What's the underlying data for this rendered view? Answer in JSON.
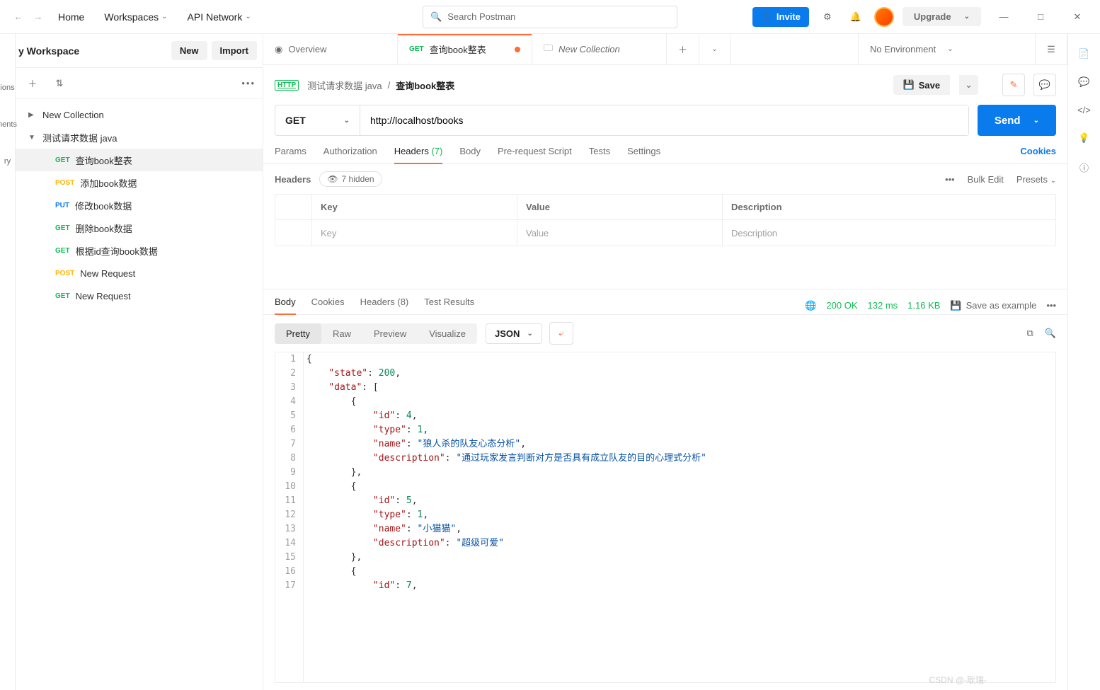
{
  "topbar": {
    "home": "Home",
    "workspaces": "Workspaces",
    "api_network": "API Network",
    "search_placeholder": "Search Postman",
    "invite": "Invite",
    "upgrade": "Upgrade"
  },
  "sidebar": {
    "workspace_title": "y Workspace",
    "new_btn": "New",
    "import_btn": "Import",
    "rail": {
      "ions": "ions",
      "nents": "nents",
      "ry": "ry"
    },
    "tree": [
      {
        "type": "folder",
        "label": "New Collection",
        "chev": "▶"
      },
      {
        "type": "folder",
        "label": "测试请求数据 java",
        "chev": "▼"
      },
      {
        "type": "req",
        "method": "GET",
        "label": "查询book整表",
        "active": true
      },
      {
        "type": "req",
        "method": "POST",
        "label": "添加book数据"
      },
      {
        "type": "req",
        "method": "PUT",
        "label": "修改book数据"
      },
      {
        "type": "req",
        "method": "GET",
        "label": "删除book数据"
      },
      {
        "type": "req",
        "method": "GET",
        "label": "根据id查询book数据"
      },
      {
        "type": "req",
        "method": "POST",
        "label": "New Request"
      },
      {
        "type": "req",
        "method": "GET",
        "label": "New Request"
      }
    ]
  },
  "tabs": {
    "items": [
      {
        "icon": "overview",
        "label": "Overview"
      },
      {
        "method": "GET",
        "label": "查询book整表",
        "active": true,
        "dirty": true
      },
      {
        "icon": "collection",
        "label": "New Collection",
        "italic": true
      }
    ],
    "env": "No Environment"
  },
  "request": {
    "breadcrumb_parent": "测试请求数据 java",
    "breadcrumb_name": "查询book整表",
    "save": "Save",
    "method": "GET",
    "url": "http://localhost/books",
    "send": "Send",
    "subtabs": {
      "params": "Params",
      "auth": "Authorization",
      "headers": "Headers",
      "headers_count": "(7)",
      "body": "Body",
      "prereq": "Pre-request Script",
      "tests": "Tests",
      "settings": "Settings",
      "cookies": "Cookies"
    },
    "headers_section": {
      "title": "Headers",
      "hidden": "7 hidden",
      "bulk_edit": "Bulk Edit",
      "presets": "Presets",
      "cols": {
        "key": "Key",
        "value": "Value",
        "desc": "Description"
      },
      "placeholder": {
        "key": "Key",
        "value": "Value",
        "desc": "Description"
      }
    }
  },
  "response": {
    "tabs": {
      "body": "Body",
      "cookies": "Cookies",
      "headers": "Headers",
      "headers_count": "(8)",
      "test_results": "Test Results"
    },
    "status_code": "200 OK",
    "time": "132 ms",
    "size": "1.16 KB",
    "save_example": "Save as example",
    "view_modes": {
      "pretty": "Pretty",
      "raw": "Raw",
      "preview": "Preview",
      "visualize": "Visualize"
    },
    "format": "JSON",
    "code_lines": [
      [
        [
          "punc",
          "{"
        ]
      ],
      [
        [
          "pad",
          "    "
        ],
        [
          "key",
          "\"state\""
        ],
        [
          "punc",
          ": "
        ],
        [
          "num",
          "200"
        ],
        [
          "punc",
          ","
        ]
      ],
      [
        [
          "pad",
          "    "
        ],
        [
          "key",
          "\"data\""
        ],
        [
          "punc",
          ": ["
        ]
      ],
      [
        [
          "pad",
          "        "
        ],
        [
          "punc",
          "{"
        ]
      ],
      [
        [
          "pad",
          "            "
        ],
        [
          "key",
          "\"id\""
        ],
        [
          "punc",
          ": "
        ],
        [
          "num",
          "4"
        ],
        [
          "punc",
          ","
        ]
      ],
      [
        [
          "pad",
          "            "
        ],
        [
          "key",
          "\"type\""
        ],
        [
          "punc",
          ": "
        ],
        [
          "num",
          "1"
        ],
        [
          "punc",
          ","
        ]
      ],
      [
        [
          "pad",
          "            "
        ],
        [
          "key",
          "\"name\""
        ],
        [
          "punc",
          ": "
        ],
        [
          "str",
          "\"狼人杀的队友心态分析\""
        ],
        [
          "punc",
          ","
        ]
      ],
      [
        [
          "pad",
          "            "
        ],
        [
          "key",
          "\"description\""
        ],
        [
          "punc",
          ": "
        ],
        [
          "str",
          "\"通过玩家发言判断对方是否具有成立队友的目的心理式分析\""
        ]
      ],
      [
        [
          "pad",
          "        "
        ],
        [
          "punc",
          "},"
        ]
      ],
      [
        [
          "pad",
          "        "
        ],
        [
          "punc",
          "{"
        ]
      ],
      [
        [
          "pad",
          "            "
        ],
        [
          "key",
          "\"id\""
        ],
        [
          "punc",
          ": "
        ],
        [
          "num",
          "5"
        ],
        [
          "punc",
          ","
        ]
      ],
      [
        [
          "pad",
          "            "
        ],
        [
          "key",
          "\"type\""
        ],
        [
          "punc",
          ": "
        ],
        [
          "num",
          "1"
        ],
        [
          "punc",
          ","
        ]
      ],
      [
        [
          "pad",
          "            "
        ],
        [
          "key",
          "\"name\""
        ],
        [
          "punc",
          ": "
        ],
        [
          "str",
          "\"小猫猫\""
        ],
        [
          "punc",
          ","
        ]
      ],
      [
        [
          "pad",
          "            "
        ],
        [
          "key",
          "\"description\""
        ],
        [
          "punc",
          ": "
        ],
        [
          "str",
          "\"超级可爱\""
        ]
      ],
      [
        [
          "pad",
          "        "
        ],
        [
          "punc",
          "},"
        ]
      ],
      [
        [
          "pad",
          "        "
        ],
        [
          "punc",
          "{"
        ]
      ],
      [
        [
          "pad",
          "            "
        ],
        [
          "key",
          "\"id\""
        ],
        [
          "punc",
          ": "
        ],
        [
          "num",
          "7"
        ],
        [
          "punc",
          ","
        ]
      ]
    ]
  },
  "watermark": "CSDN @-耿瑞-"
}
